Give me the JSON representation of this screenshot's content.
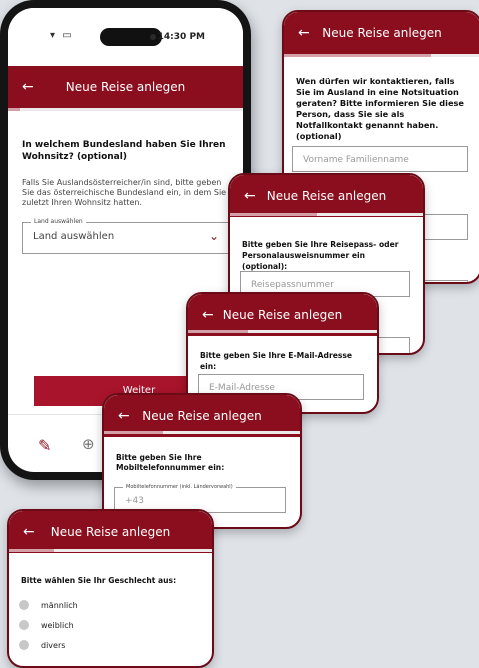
{
  "phone": {
    "status_time": "14:30 PM",
    "title": "Neue Reise anlegen",
    "question": "In welchem Bundesland haben Sie Ihren Wohnsitz? (optional)",
    "hint": "Falls Sie Auslandsösterreicher/in sind, bitte geben Sie das österreichische Bundesland ein, in dem Sie zuletzt Ihren Wohnsitz hatten.",
    "select_legend": "Land auswählen",
    "select_value": "Land auswählen",
    "continue_label": "Weiter",
    "progress": 0.05
  },
  "card_contact": {
    "title": "Neue Reise anlegen",
    "question": "Wen dürfen wir kontaktieren, falls Sie im Ausland in eine Notsituation geraten? Bitte informieren Sie diese Person, dass Sie sie als Notfallkontakt genannt haben. (optional)",
    "name_placeholder": "Vorname Familienname",
    "progress": 0.75
  },
  "card_passport": {
    "title": "Neue Reise anlegen",
    "question": "Bitte geben Sie Ihre Reisepass- oder Personalausweisnummer ein (optional):",
    "placeholder": "Reisepassnummer",
    "progress": 0.45
  },
  "card_email": {
    "title": "Neue Reise anlegen",
    "question": "Bitte geben Sie Ihre E-Mail-Adresse ein:",
    "placeholder": "E-Mail-Adresse",
    "progress": 0.32
  },
  "card_mobile": {
    "title": "Neue Reise anlegen",
    "question": "Bitte geben Sie Ihre Mobiltelefonnummer ein:",
    "legend": "Mobiltelefonnummer (inkl. Ländervorwahl)",
    "value": "+43",
    "progress": 0.3
  },
  "card_gender": {
    "title": "Neue Reise anlegen",
    "question": "Bitte wählen Sie Ihr Geschlecht aus:",
    "options": [
      "männlich",
      "weiblich",
      "divers"
    ],
    "progress": 0.22
  },
  "colors": {
    "brand": "#8b0e1e",
    "progress_fill": "#d4a0a8"
  }
}
